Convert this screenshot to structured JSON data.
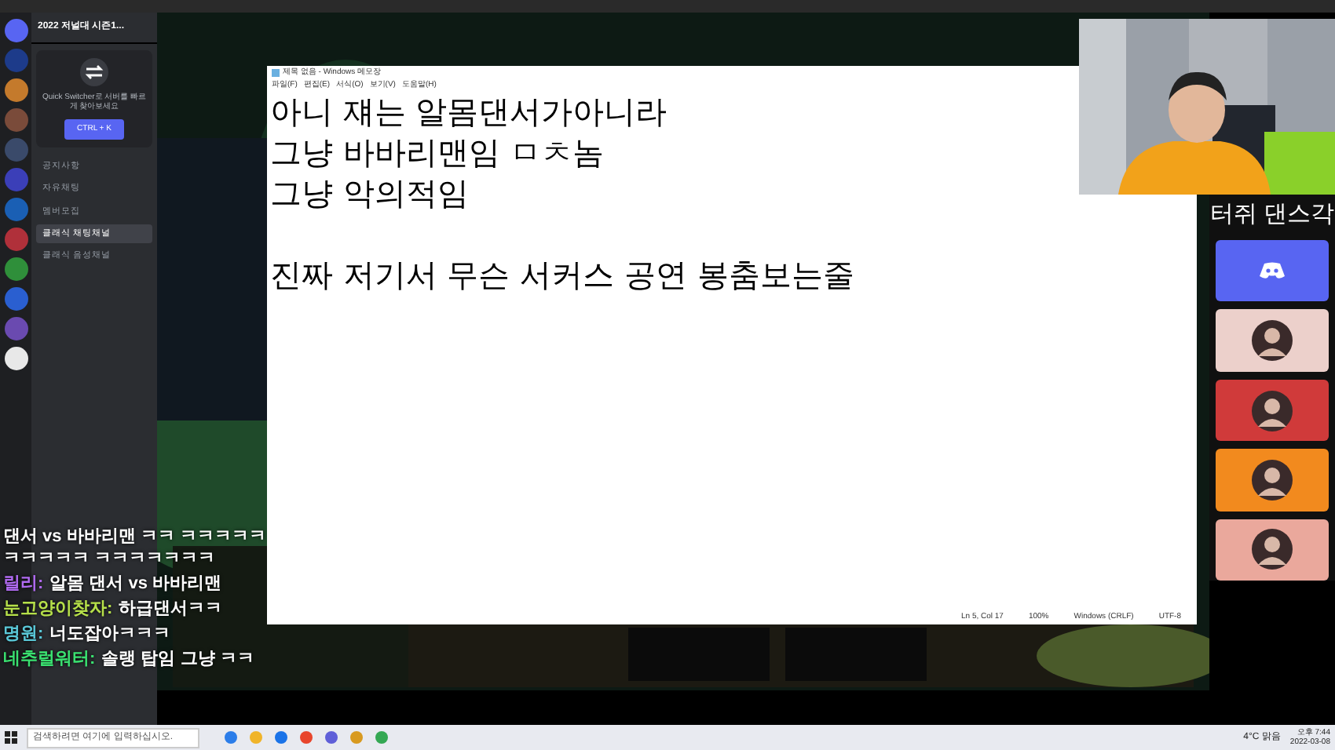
{
  "servers": [
    {
      "color": "#5865f2"
    },
    {
      "color": "#1d3b8a"
    },
    {
      "color": "#c47a2c"
    },
    {
      "color": "#7a4b3a"
    },
    {
      "color": "#3a4a6a"
    },
    {
      "color": "#3b3fb8"
    },
    {
      "color": "#1a5fb4"
    },
    {
      "color": "#b0303a"
    },
    {
      "color": "#2f8f3a"
    },
    {
      "color": "#2a5fd0"
    },
    {
      "color": "#6a4ab0"
    },
    {
      "color": "#e8e8e8"
    }
  ],
  "server_name": "2022 저널대 시즌1...",
  "quick_switcher": {
    "text": "Quick Switcher로 서버를 빠르게 찾아보세요",
    "button": "CTRL + K"
  },
  "channels": [
    {
      "name": "공지사항",
      "selected": false
    },
    {
      "name": "자유채팅",
      "selected": false
    },
    {
      "name": "멤버모집",
      "selected": false
    },
    {
      "name": "클래식 채팅채널",
      "selected": true
    },
    {
      "name": "클래식 음성채널",
      "selected": false
    }
  ],
  "notepad": {
    "title": "제목 없음 - Windows 메모장",
    "menu": [
      "파일(F)",
      "편집(E)",
      "서식(O)",
      "보기(V)",
      "도움말(H)"
    ],
    "paragraphs": [
      {
        "lines": [
          "아니 쟤는 알몸댄서가아니라",
          "그냥 바바리맨임 ㅁㅊ놈",
          "그냥 악의적임"
        ]
      },
      {
        "lines": [
          "진짜 저기서 무슨 서커스 공연 봉춤보는줄"
        ]
      }
    ],
    "status": [
      "Ln 5, Col 17",
      "100%",
      "Windows (CRLF)",
      "UTF-8"
    ]
  },
  "panel_title": "터쥐 댄스각",
  "tiles": [
    {
      "kind": "discord",
      "color": "#5865f2"
    },
    {
      "kind": "avatar",
      "color": "#ecd0cb"
    },
    {
      "kind": "avatar",
      "color": "#d03a3a"
    },
    {
      "kind": "avatar",
      "color": "#f28a1e"
    },
    {
      "kind": "avatar",
      "color": "#eaa89c"
    }
  ],
  "chat": [
    {
      "message": "댄서 vs 바바리맨 ㅋㅋ ㅋㅋㅋㅋㅋㅋㅋㅋㅋㅋ ㅋㅋㅋㅋㅋㅋㅋ"
    },
    {
      "name": "릴리:",
      "color": "#b06af0",
      "message": "알몸 댄서 vs 바바리맨"
    },
    {
      "name": "눈고양이찾자:",
      "color": "#b6e04a",
      "message": "하급댄서ㅋㅋ"
    },
    {
      "name": "명원:",
      "color": "#5ac8d8",
      "message": "너도잡아ㅋㅋㅋ"
    },
    {
      "name": "네추럴워터:",
      "color": "#3ae070",
      "message": "솔랭 탑임 그냥 ㅋㅋ"
    }
  ],
  "taskbar": {
    "search_placeholder": "검색하려면 여기에 입력하십시오.",
    "weather": "4°C 맑음",
    "time": "오후 7:44",
    "date": "2022-03-08"
  }
}
